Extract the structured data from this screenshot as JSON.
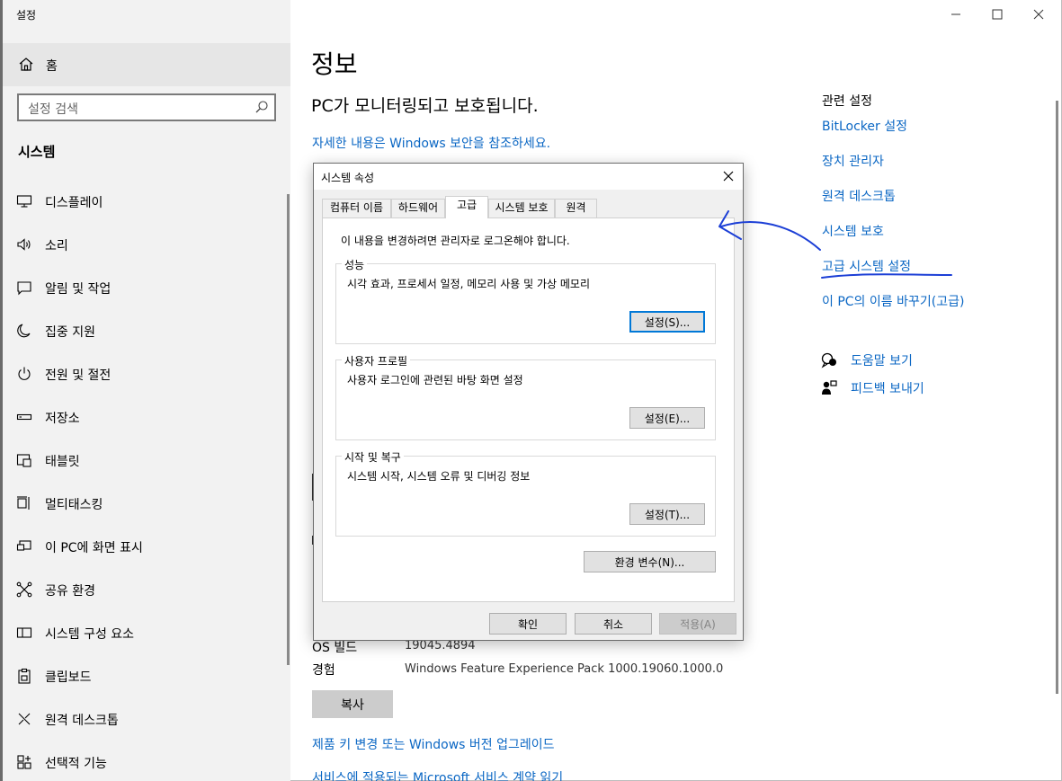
{
  "window": {
    "title": "설정",
    "minimize_glyph": "—",
    "maximize_glyph": "☐",
    "close_glyph": "✕"
  },
  "sidebar": {
    "home_label": "홈",
    "search_placeholder": "설정 검색",
    "section_title": "시스템",
    "items": [
      {
        "label": "디스플레이",
        "icon": "display-icon"
      },
      {
        "label": "소리",
        "icon": "speaker-icon"
      },
      {
        "label": "알림 및 작업",
        "icon": "notification-icon"
      },
      {
        "label": "집중 지원",
        "icon": "moon-icon"
      },
      {
        "label": "전원 및 절전",
        "icon": "power-icon"
      },
      {
        "label": "저장소",
        "icon": "storage-icon"
      },
      {
        "label": "태블릿",
        "icon": "tablet-icon"
      },
      {
        "label": "멀티태스킹",
        "icon": "multitasking-icon"
      },
      {
        "label": "이 PC에 화면 표시",
        "icon": "project-icon"
      },
      {
        "label": "공유 환경",
        "icon": "share-icon"
      },
      {
        "label": "시스템 구성 요소",
        "icon": "components-icon"
      },
      {
        "label": "클립보드",
        "icon": "clipboard-icon"
      },
      {
        "label": "원격 데스크톱",
        "icon": "remote-desktop-icon"
      },
      {
        "label": "선택적 기능",
        "icon": "optional-features-icon"
      }
    ]
  },
  "main": {
    "title": "정보",
    "protected_text": "PC가 모니터링되고 보호됩니다.",
    "more_info_link": "자세한 내용은 Windows 보안을 참조하세요.",
    "specs": [
      {
        "key": "OS 빌드",
        "value": "19045.4894"
      },
      {
        "key": "경험",
        "value": "Windows Feature Experience Pack 1000.19060.1000.0"
      }
    ],
    "copy_button": "복사",
    "upgrade_link": "제품 키 변경 또는 Windows 버전 업그레이드",
    "terms_link": "서비스에 적용되는 Microsoft 서비스 계약 읽기"
  },
  "related": {
    "title": "관련 설정",
    "links": [
      "BitLocker 설정",
      "장치 관리자",
      "원격 데스크톱",
      "시스템 보호",
      "고급 시스템 설정",
      "이 PC의 이름 바꾸기(고급)"
    ],
    "help_link": "도움말 보기",
    "feedback_link": "피드백 보내기"
  },
  "dialog": {
    "title": "시스템 속성",
    "close_glyph": "✕",
    "tabs": [
      "컴퓨터 이름",
      "하드웨어",
      "고급",
      "시스템 보호",
      "원격"
    ],
    "active_tab": "고급",
    "admin_note": "이 내용을 변경하려면 관리자로 로그온해야 합니다.",
    "groups": [
      {
        "title": "성능",
        "description": "시각 효과, 프로세서 일정, 메모리 사용 및 가상 메모리",
        "button": "설정(S)..."
      },
      {
        "title": "사용자 프로필",
        "description": "사용자 로그인에 관련된 바탕 화면 설정",
        "button": "설정(E)..."
      },
      {
        "title": "시작 및 복구",
        "description": "시스템 시작, 시스템 오류 및 디버깅 정보",
        "button": "설정(T)..."
      }
    ],
    "env_button": "환경 변수(N)...",
    "ok_button": "확인",
    "cancel_button": "취소",
    "apply_button": "적용(A)"
  },
  "colors": {
    "link": "#0b67c4",
    "annotation_ink": "#1c3fd6",
    "focus_border": "#0078d7"
  }
}
